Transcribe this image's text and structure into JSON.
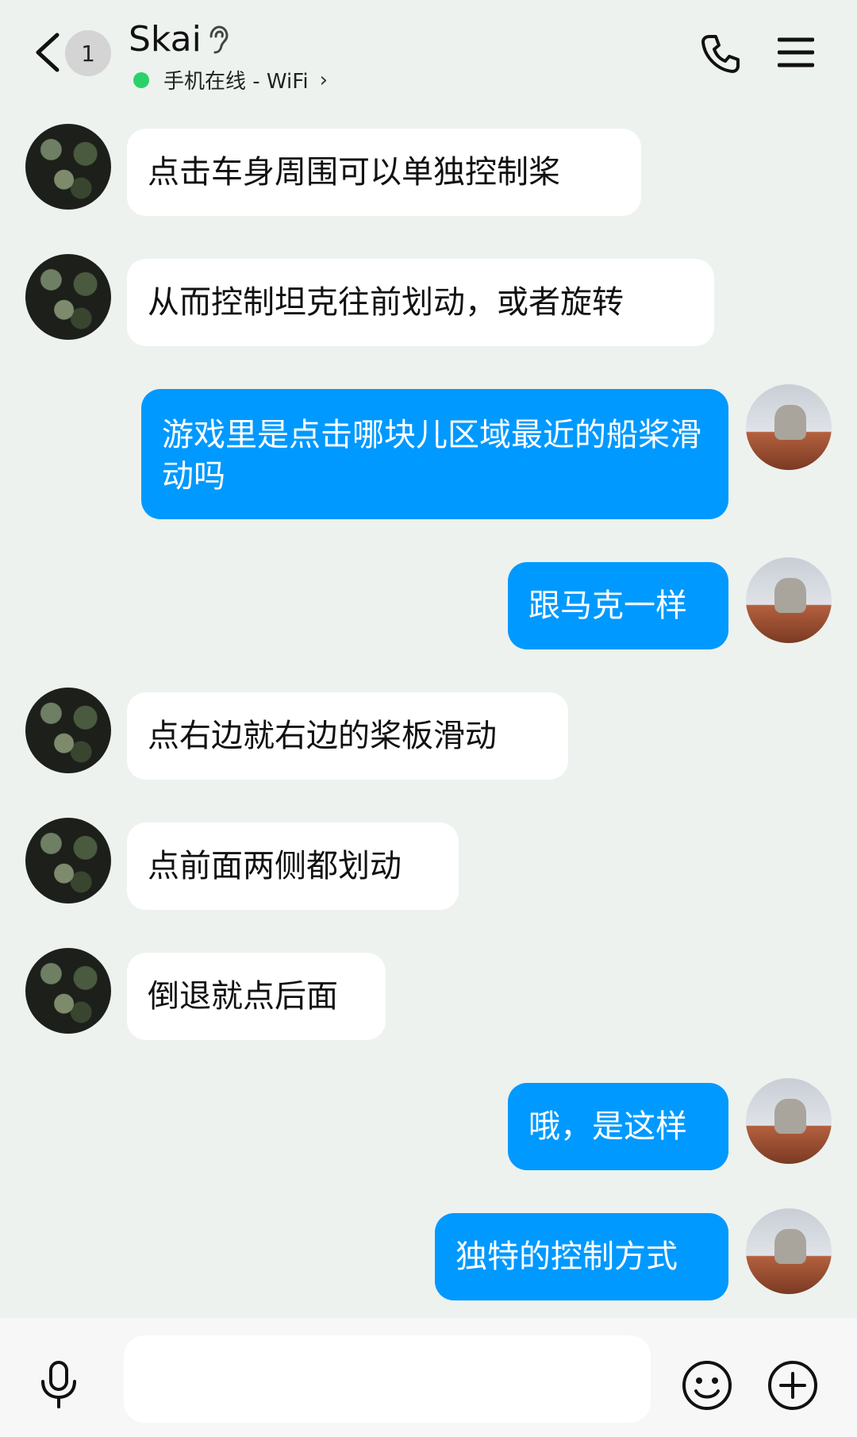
{
  "header": {
    "unread_count": "1",
    "title": "Skai",
    "status": "手机在线 - WiFi",
    "status_color": "#2bd26a"
  },
  "messages": [
    {
      "from": "other",
      "text": "点击车身周围可以单独控制桨"
    },
    {
      "from": "other",
      "text": "从而控制坦克往前划动，或者旋转"
    },
    {
      "from": "self",
      "text": "游戏里是点击哪块儿区域最近的船桨滑动吗"
    },
    {
      "from": "self",
      "text": "跟马克一样"
    },
    {
      "from": "other",
      "text": "点右边就右边的桨板滑动"
    },
    {
      "from": "other",
      "text": "点前面两侧都划动"
    },
    {
      "from": "other",
      "text": "倒退就点后面"
    },
    {
      "from": "self",
      "text": "哦，是这样"
    },
    {
      "from": "self",
      "text": "独特的控制方式"
    }
  ],
  "input": {
    "value": ""
  },
  "colors": {
    "self_bubble": "#0099ff",
    "other_bubble": "#ffffff",
    "background": "#edf2ef"
  },
  "icons": [
    "back-arrow-icon",
    "ear-icon",
    "phone-icon",
    "menu-icon",
    "microphone-icon",
    "emoji-icon",
    "plus-icon"
  ]
}
